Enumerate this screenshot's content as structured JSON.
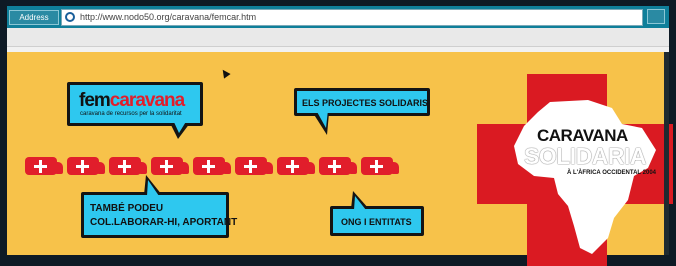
{
  "browser": {
    "address_label": "Address",
    "url": "http://www.nodo50.org/caravana/femcar.htm"
  },
  "site": {
    "logo_part1": "fem",
    "logo_part2": "caravana",
    "logo_subtitle": "caravana de recursos per la solidaritat"
  },
  "bubbles": {
    "projects": "ELS PROJECTES SOLIDARIS",
    "collaborate_line1": "TAMBÉ PODEU",
    "collaborate_line2": "COL.LABORAR-HI, APORTANT",
    "ngo": "ONG I ENTITATS"
  },
  "poster": {
    "line1": "CARAVANA",
    "line2": "SOLIDARIA",
    "line3": "À L'ÀFRICA OCCIDENTAL 2004"
  },
  "colors": {
    "background": "#f7c24a",
    "bubble": "#2ec8ef",
    "red": "#e11e2b"
  },
  "icons": [
    "ie-icon",
    "go-icon",
    "truck-icon",
    "red-cross-icon",
    "africa-map-icon",
    "mouse-cursor-icon"
  ]
}
